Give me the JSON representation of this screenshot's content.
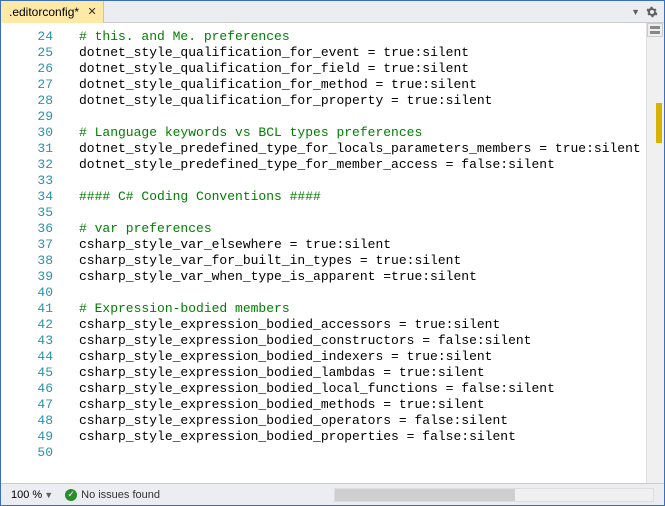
{
  "tab": {
    "label": ".editorconfig*"
  },
  "zoom": "100 %",
  "status": {
    "issues": "No issues found"
  },
  "code": {
    "startLine": 24,
    "lines": [
      {
        "n": 24,
        "t": "comment",
        "text": "# this. and Me. preferences"
      },
      {
        "n": 25,
        "t": "setting",
        "key": "dotnet_style_qualification_for_event",
        "rest": " = true:silent"
      },
      {
        "n": 26,
        "t": "setting",
        "key": "dotnet_style_qualification_for_field",
        "rest": " = true:silent"
      },
      {
        "n": 27,
        "t": "setting",
        "key": "dotnet_style_qualification_for_method",
        "rest": " = true:silent"
      },
      {
        "n": 28,
        "t": "setting",
        "key": "dotnet_style_qualification_for_property",
        "rest": " = true:silent"
      },
      {
        "n": 29,
        "t": "blank",
        "text": ""
      },
      {
        "n": 30,
        "t": "comment",
        "text": "# Language keywords vs BCL types preferences"
      },
      {
        "n": 31,
        "t": "setting",
        "key": "dotnet_style_predefined_type_for_locals_parameters_members",
        "rest": " = true:silent"
      },
      {
        "n": 32,
        "t": "setting",
        "key": "dotnet_style_predefined_type_for_member_access",
        "rest": " = false:silent"
      },
      {
        "n": 33,
        "t": "blank",
        "text": ""
      },
      {
        "n": 34,
        "t": "comment",
        "text": "#### C# Coding Conventions ####"
      },
      {
        "n": 35,
        "t": "blank",
        "text": ""
      },
      {
        "n": 36,
        "t": "comment",
        "text": "# var preferences"
      },
      {
        "n": 37,
        "t": "setting",
        "key": "csharp_style_var_elsewhere",
        "rest": " = true:silent"
      },
      {
        "n": 38,
        "t": "setting",
        "key": "csharp_style_var_for_built_in_types",
        "rest": " = true:silent"
      },
      {
        "n": 39,
        "t": "setting",
        "key": "csharp_style_var_when_type_is_apparent",
        "rest": " =true:silent"
      },
      {
        "n": 40,
        "t": "blank",
        "text": ""
      },
      {
        "n": 41,
        "t": "comment",
        "text": "# Expression-bodied members"
      },
      {
        "n": 42,
        "t": "setting",
        "key": "csharp_style_expression_bodied_accessors",
        "rest": " = true:silent"
      },
      {
        "n": 43,
        "t": "setting",
        "key": "csharp_style_expression_bodied_constructors",
        "rest": " = false:silent"
      },
      {
        "n": 44,
        "t": "setting",
        "key": "csharp_style_expression_bodied_indexers",
        "rest": " = true:silent"
      },
      {
        "n": 45,
        "t": "setting",
        "key": "csharp_style_expression_bodied_lambdas",
        "rest": " = true:silent"
      },
      {
        "n": 46,
        "t": "setting",
        "key": "csharp_style_expression_bodied_local_functions",
        "rest": " = false:silent"
      },
      {
        "n": 47,
        "t": "setting",
        "key": "csharp_style_expression_bodied_methods",
        "rest": " = true:silent"
      },
      {
        "n": 48,
        "t": "setting",
        "key": "csharp_style_expression_bodied_operators",
        "rest": " = false:silent"
      },
      {
        "n": 49,
        "t": "setting",
        "key": "csharp_style_expression_bodied_properties",
        "rest": " = false:silent"
      },
      {
        "n": 50,
        "t": "blank",
        "text": ""
      }
    ]
  }
}
